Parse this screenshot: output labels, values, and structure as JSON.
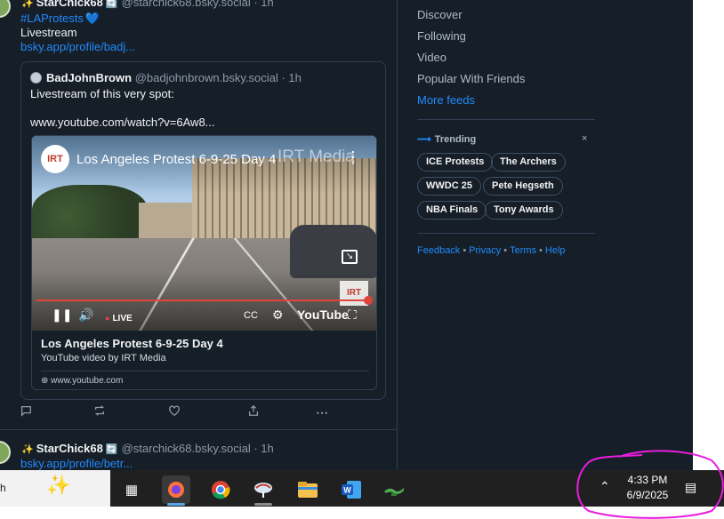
{
  "post1": {
    "star": "✨",
    "display_name": "StarChick68",
    "badge": "🔄",
    "handle": "@starchick68.bsky.social · 1h",
    "hashtag": "#LAProtests",
    "heart": "💙",
    "text": "Livestream",
    "link": "bsky.app/profile/badj..."
  },
  "quote": {
    "display_name": "BadJohnBrown",
    "handle": "@badjohnbrown.bsky.social · 1h",
    "text_line1": "Livestream of this very spot:",
    "text_line2": "www.youtube.com/watch?v=6Aw8...",
    "embed": {
      "video_title": "Los Angeles Protest 6-9-25 Day 4",
      "watermark": "IRT Media",
      "live_label": "LIVE",
      "youtube_label": "YouTube",
      "title": "Los Angeles Protest 6-9-25 Day 4",
      "description": "YouTube video by IRT Media",
      "domain": "www.youtube.com",
      "progress": 0.99
    }
  },
  "actions": [
    "reply-icon",
    "repost-icon",
    "like-icon",
    "share-icon",
    "more-icon"
  ],
  "post2": {
    "star": "✨",
    "display_name": "StarChick68",
    "badge": "🔄",
    "handle": "@starchick68.bsky.social · 1h",
    "link": "bsky.app/profile/betr..."
  },
  "right_panel": {
    "feeds": [
      "Discover",
      "Following",
      "Video",
      "Popular With Friends"
    ],
    "more_feeds": "More feeds",
    "trending_title": "Trending",
    "trending_close": "×",
    "trending": [
      "ICE Protests",
      "The Archers",
      "WWDC 25",
      "Pete Hegseth",
      "NBA Finals",
      "Tony Awards"
    ],
    "footer": [
      "Feedback",
      "Privacy",
      "Terms",
      "Help"
    ]
  },
  "taskbar": {
    "search_fragment": "h",
    "time": "4:33 PM",
    "date": "6/9/2025",
    "apps": [
      "task-view-icon",
      "firefox-icon",
      "chrome-icon",
      "app-icon",
      "file-explorer-icon",
      "word-icon",
      "genie-icon"
    ]
  },
  "colors": {
    "background": "#161e27",
    "accent": "#208bfe",
    "border": "#2e4052",
    "annotation": "#e81ee0"
  }
}
